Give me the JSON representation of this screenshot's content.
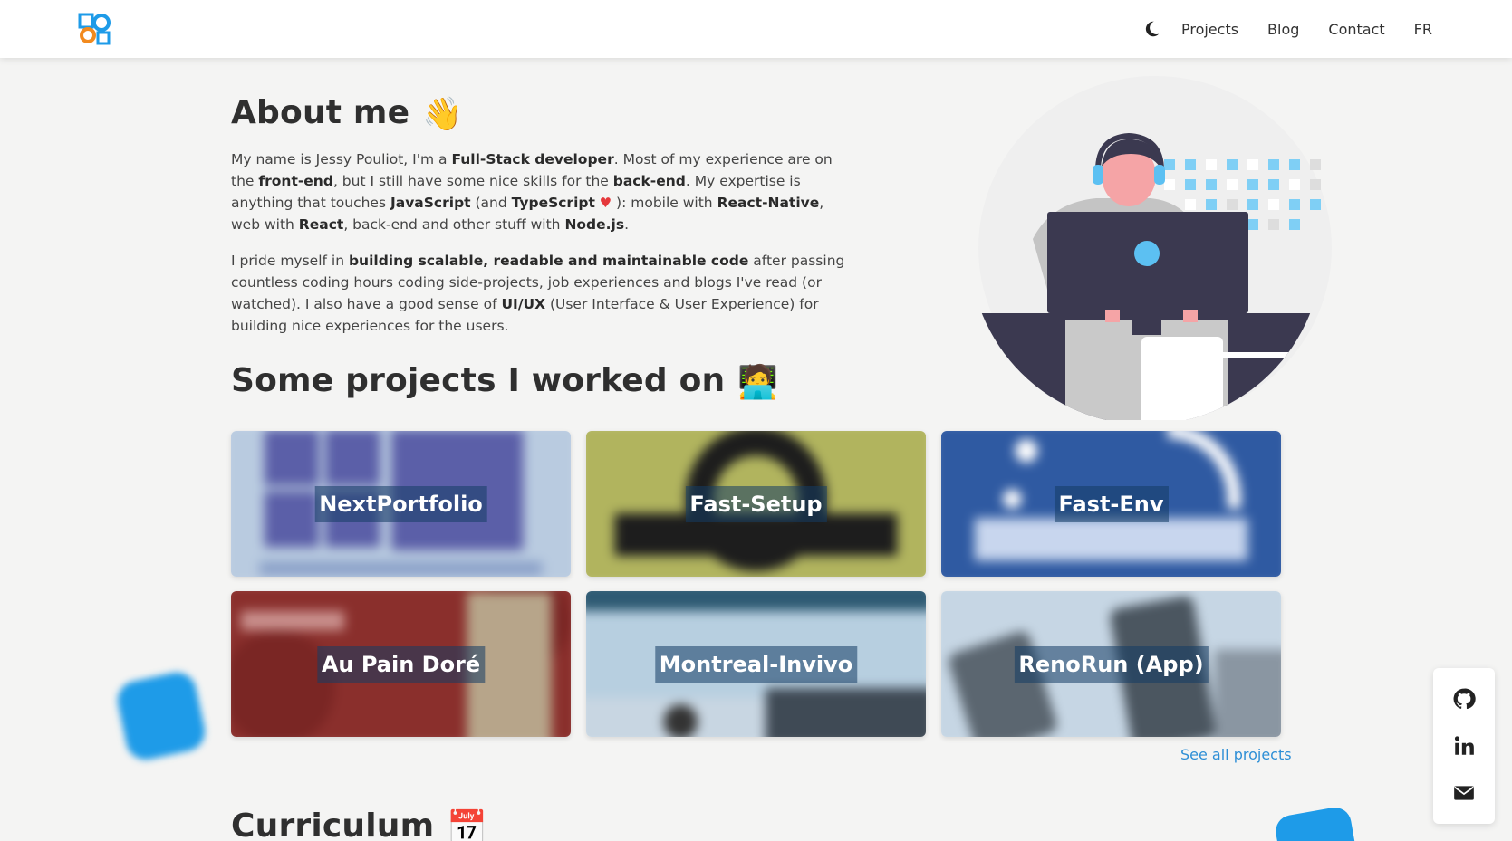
{
  "nav": {
    "theme_toggle": "moon-icon",
    "links": [
      "Projects",
      "Blog",
      "Contact",
      "FR"
    ]
  },
  "about": {
    "title": "About me",
    "emoji": "👋",
    "p1": [
      {
        "t": "My name is Jessy Pouliot, I'm a "
      },
      {
        "b": "Full-Stack developer"
      },
      {
        "t": ". Most of my experience are on the "
      },
      {
        "b": "front-end"
      },
      {
        "t": ", but I still have some nice skills for the "
      },
      {
        "b": "back-end"
      },
      {
        "t": ". My expertise is anything that touches "
      },
      {
        "b": "JavaScript"
      },
      {
        "t": " (and "
      },
      {
        "b": "TypeScript"
      },
      {
        "h": " ♥"
      },
      {
        "t": " ): mobile with "
      },
      {
        "b": "React-Native"
      },
      {
        "t": ", web with "
      },
      {
        "b": "React"
      },
      {
        "t": ", back-end and other stuff with "
      },
      {
        "b": "Node.js"
      },
      {
        "t": "."
      }
    ],
    "p2": [
      {
        "t": "I pride myself in "
      },
      {
        "b": "building scalable, readable and maintainable code"
      },
      {
        "t": " after passing countless coding hours coding side-projects, job experiences and blogs I've read (or watched). I also have a good sense of "
      },
      {
        "b": "UI/UX"
      },
      {
        "t": " (User Interface & User Experience) for building nice experiences for the users."
      }
    ]
  },
  "projects": {
    "title": "Some projects I worked on",
    "emoji": "🧑‍💻",
    "items": [
      {
        "label": "NextPortfolio",
        "color": "#b9cbe0"
      },
      {
        "label": "Fast-Setup",
        "color": "#b1b45e"
      },
      {
        "label": "Fast-Env",
        "color": "#2f5aa2"
      },
      {
        "label": "Au Pain Doré",
        "color": "#8a2f2c"
      },
      {
        "label": "Montreal-Invivo",
        "color": "#b7cfe0"
      },
      {
        "label": "RenoRun (App)",
        "color": "#c6d6e4"
      }
    ],
    "see_all": "See all projects"
  },
  "curriculum": {
    "title": "Curriculum",
    "emoji": "📅"
  },
  "social": [
    "github-icon",
    "linkedin-icon",
    "mail-icon"
  ],
  "colors": {
    "accent": "#2e8fd6",
    "blob": "#1e9be8"
  }
}
